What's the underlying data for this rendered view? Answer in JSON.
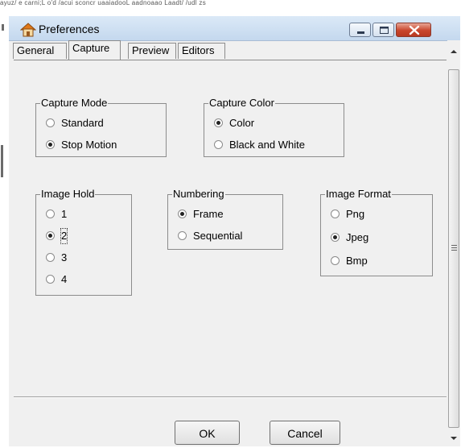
{
  "background": {
    "garbled_text": "ayuz/ e carni;L o'd /acui sconcr uaaiadooL aadnoaao Laadt/ /udl zs"
  },
  "window": {
    "title": "Preferences"
  },
  "titlebar_buttons": {
    "minimize_icon": "minimize-icon",
    "maximize_icon": "maximize-icon",
    "close_icon": "close-icon"
  },
  "tabs": [
    {
      "label": "General",
      "active": false
    },
    {
      "label": "Capture",
      "active": true
    },
    {
      "label": "Preview",
      "active": false
    },
    {
      "label": "Editors",
      "active": false
    }
  ],
  "groups": {
    "capture_mode": {
      "legend": "Capture Mode",
      "options": [
        "Standard",
        "Stop Motion"
      ],
      "selected": "Stop Motion"
    },
    "capture_color": {
      "legend": "Capture Color",
      "options": [
        "Color",
        "Black and White"
      ],
      "selected": "Color"
    },
    "image_hold": {
      "legend": "Image Hold",
      "options": [
        "1",
        "2",
        "3",
        "4"
      ],
      "selected": "2"
    },
    "numbering": {
      "legend": "Numbering",
      "options": [
        "Frame",
        "Sequential"
      ],
      "selected": "Frame"
    },
    "image_format": {
      "legend": "Image Format",
      "options": [
        "Png",
        "Jpeg",
        "Bmp"
      ],
      "selected": "Jpeg"
    }
  },
  "buttons": {
    "ok": "OK",
    "cancel": "Cancel"
  },
  "colors": {
    "titlebar": "#c4d8ee",
    "close_button": "#c9462c",
    "window_bg": "#f0f0f0"
  }
}
